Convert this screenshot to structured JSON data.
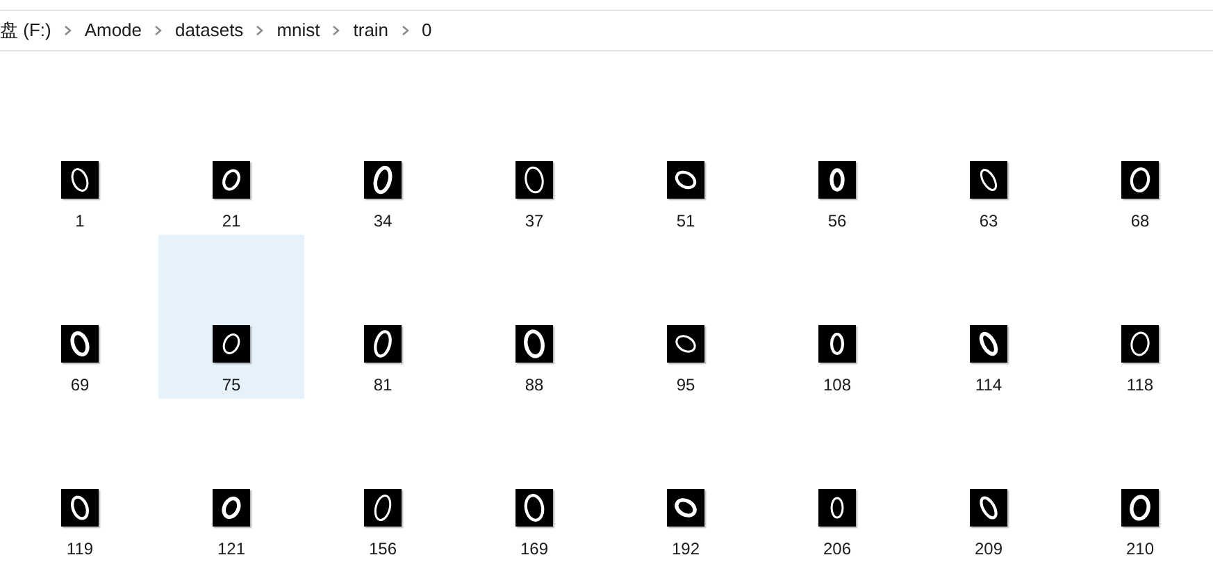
{
  "breadcrumb": [
    "盘 (F:)",
    "Amode",
    "datasets",
    "mnist",
    "train",
    "0"
  ],
  "files": [
    {
      "name": "1",
      "selected": false
    },
    {
      "name": "21",
      "selected": false
    },
    {
      "name": "34",
      "selected": false
    },
    {
      "name": "37",
      "selected": false
    },
    {
      "name": "51",
      "selected": false
    },
    {
      "name": "56",
      "selected": false
    },
    {
      "name": "63",
      "selected": false
    },
    {
      "name": "68",
      "selected": false
    },
    {
      "name": "69",
      "selected": false
    },
    {
      "name": "75",
      "selected": true
    },
    {
      "name": "81",
      "selected": false
    },
    {
      "name": "88",
      "selected": false
    },
    {
      "name": "95",
      "selected": false
    },
    {
      "name": "108",
      "selected": false
    },
    {
      "name": "114",
      "selected": false
    },
    {
      "name": "118",
      "selected": false
    },
    {
      "name": "119",
      "selected": false
    },
    {
      "name": "121",
      "selected": false
    },
    {
      "name": "156",
      "selected": false
    },
    {
      "name": "169",
      "selected": false
    },
    {
      "name": "192",
      "selected": false
    },
    {
      "name": "206",
      "selected": false
    },
    {
      "name": "209",
      "selected": false
    },
    {
      "name": "210",
      "selected": false
    }
  ]
}
